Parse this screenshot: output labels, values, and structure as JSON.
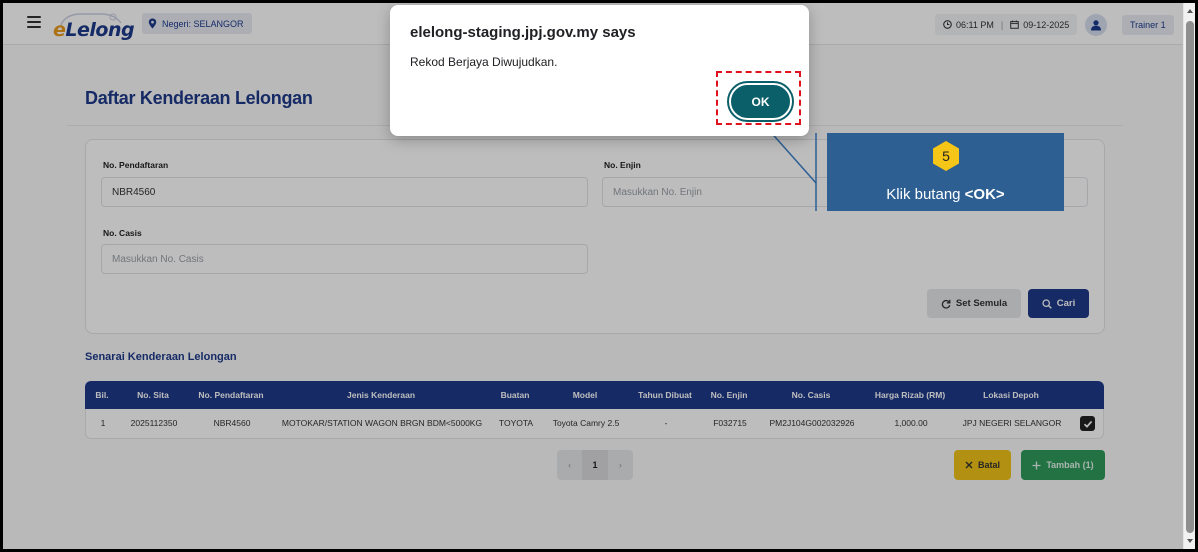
{
  "header": {
    "logo_prefix": "e",
    "logo_text": "Lelong",
    "state": "Negeri: SELANGOR",
    "time": "06:11 PM",
    "date": "09-12-2025",
    "user": "Trainer 1"
  },
  "page": {
    "title": "Daftar Kenderaan Lelongan"
  },
  "form": {
    "no_pendaftaran_label": "No. Pendaftaran",
    "no_pendaftaran_value": "NBR4560",
    "no_enjin_label": "No. Enjin",
    "no_enjin_placeholder": "Masukkan No. Enjin",
    "no_casis_label": "No. Casis",
    "no_casis_placeholder": "Masukkan No. Casis",
    "reset_label": "Set Semula",
    "search_label": "Cari"
  },
  "list": {
    "title": "Senarai Kenderaan Lelongan",
    "columns": [
      "Bil.",
      "No. Sita",
      "No. Pendaftaran",
      "Jenis Kenderaan",
      "Buatan",
      "Model",
      "Tahun Dibuat",
      "No. Enjin",
      "No. Casis",
      "Harga Rizab (RM)",
      "Lokasi Depoh"
    ],
    "rows": [
      [
        "1",
        "2025112350",
        "NBR4560",
        "MOTOKAR/STATION WAGON BRGN BDM<5000KG",
        "TOYOTA",
        "Toyota Camry 2.5",
        "-",
        "F032715",
        "PM2J104G002032926",
        "1,000.00",
        "JPJ NEGERI SELANGOR"
      ]
    ]
  },
  "pagination": {
    "prev": "‹",
    "current": "1",
    "next": "›"
  },
  "actions": {
    "cancel_label": "Batal",
    "add_label": "Tambah (1)"
  },
  "dialog": {
    "title": "elelong-staging.jpj.gov.my says",
    "message": "Rekod Berjaya Diwujudkan.",
    "ok_label": "OK"
  },
  "callout": {
    "step": "5",
    "text_prefix": "Klik butang ",
    "text_emphasis": "<OK>"
  },
  "colors": {
    "primary": "#1e3a8a",
    "accent_orange": "#e89a1c",
    "ok_button": "#0b5f69",
    "cancel": "#f0c419",
    "add": "#2e9a5c",
    "callout": "#2d5f93",
    "highlight": "#e0101c"
  }
}
